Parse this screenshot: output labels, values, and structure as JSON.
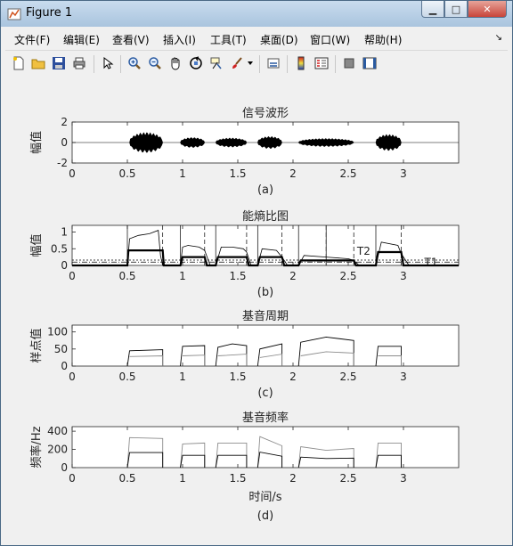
{
  "window": {
    "title": "Figure 1"
  },
  "menu": [
    {
      "label": "文件(F)"
    },
    {
      "label": "编辑(E)"
    },
    {
      "label": "查看(V)"
    },
    {
      "label": "插入(I)"
    },
    {
      "label": "工具(T)"
    },
    {
      "label": "桌面(D)"
    },
    {
      "label": "窗口(W)"
    },
    {
      "label": "帮助(H)"
    }
  ],
  "toolbar": [
    {
      "icon": "new-figure-icon"
    },
    {
      "icon": "open-file-icon"
    },
    {
      "icon": "save-icon"
    },
    {
      "icon": "print-icon"
    },
    {
      "icon": "edit-plot-arrow-icon"
    },
    {
      "icon": "zoom-in-icon"
    },
    {
      "icon": "zoom-out-icon"
    },
    {
      "icon": "pan-hand-icon"
    },
    {
      "icon": "rotate-3d-icon"
    },
    {
      "icon": "data-cursor-icon"
    },
    {
      "icon": "brush-icon"
    },
    {
      "icon": "brush-dropdown-icon"
    },
    {
      "icon": "link-plot-icon"
    },
    {
      "icon": "insert-colorbar-icon"
    },
    {
      "icon": "insert-legend-icon"
    },
    {
      "icon": "hide-plot-tools-icon"
    },
    {
      "icon": "show-plot-tools-icon"
    }
  ],
  "colors": {
    "title_bar_top": "#c9dcee",
    "close_button": "#c8453a",
    "plot_line": "#000000",
    "secondary_line": "#8c8c8c"
  },
  "chart_data": [
    {
      "type": "line",
      "title": "信号波形",
      "ylabel": "幅值",
      "caption": "(a)",
      "xlim": [
        0,
        3.5
      ],
      "ylim": [
        -2,
        2
      ],
      "xticks": [
        "0",
        "0.5",
        "1",
        "1.5",
        "2",
        "2.5",
        "3"
      ],
      "yticks": [
        "2",
        "0",
        "-2"
      ],
      "segments": [
        {
          "x": [
            0.52,
            0.82
          ],
          "amplitude": 1.0
        },
        {
          "x": [
            0.98,
            1.2
          ],
          "amplitude": 0.5
        },
        {
          "x": [
            1.3,
            1.58
          ],
          "amplitude": 0.45
        },
        {
          "x": [
            1.68,
            1.9
          ],
          "amplitude": 0.6
        },
        {
          "x": [
            2.05,
            2.55
          ],
          "amplitude": 0.4
        },
        {
          "x": [
            2.75,
            2.98
          ],
          "amplitude": 0.8
        }
      ]
    },
    {
      "type": "line",
      "title": "能熵比图",
      "ylabel": "幅值",
      "caption": "(b)",
      "xlim": [
        0,
        3.5
      ],
      "ylim": [
        0,
        1.2
      ],
      "xticks": [
        "0",
        "0.5",
        "1",
        "1.5",
        "2",
        "2.5",
        "3"
      ],
      "yticks": [
        "1",
        "0.5",
        "0"
      ],
      "annotations": [
        "T2",
        "T1"
      ],
      "thresholds": {
        "T1": 0.1,
        "T2": 0.16
      },
      "series": [
        {
          "x": [
            0,
            0.5,
            0.52,
            0.6,
            0.7,
            0.78,
            0.8,
            0.82,
            0.98,
            1.0,
            1.05,
            1.15,
            1.2,
            1.25,
            1.3,
            1.35,
            1.45,
            1.55,
            1.58,
            1.62,
            1.68,
            1.72,
            1.85,
            1.9,
            1.95,
            2.05,
            2.1,
            2.3,
            2.5,
            2.55,
            2.6,
            2.75,
            2.8,
            2.95,
            2.98,
            3.05,
            3.5
          ],
          "y": [
            0,
            0,
            0.8,
            0.9,
            0.95,
            1.05,
            0.3,
            0,
            0,
            0.55,
            0.6,
            0.55,
            0.45,
            0,
            0,
            0.55,
            0.55,
            0.5,
            0.4,
            0,
            0,
            0.5,
            0.45,
            0.25,
            0,
            0,
            0.3,
            0.25,
            0.2,
            0.15,
            0,
            0,
            0.7,
            0.6,
            0.35,
            0,
            0
          ]
        },
        {
          "x": [
            0,
            0.5,
            0.51,
            0.82,
            0.83,
            0.98,
            1.0,
            1.2,
            1.22,
            1.3,
            1.32,
            1.58,
            1.6,
            1.68,
            1.7,
            1.9,
            1.92,
            2.05,
            2.07,
            2.55,
            2.57,
            2.75,
            2.77,
            2.98,
            3.0,
            3.5
          ],
          "y": [
            0,
            0,
            0.45,
            0.45,
            0,
            0,
            0.25,
            0.25,
            0,
            0,
            0.25,
            0.25,
            0,
            0,
            0.25,
            0.25,
            0,
            0,
            0.15,
            0.15,
            0,
            0,
            0.4,
            0.4,
            0,
            0
          ]
        }
      ],
      "markers": {
        "solid": [
          0.5,
          0.98,
          1.3,
          1.68,
          2.05,
          2.3,
          2.75
        ],
        "dashed": [
          0.82,
          1.2,
          1.58,
          1.9,
          2.3,
          2.55,
          2.98
        ]
      }
    },
    {
      "type": "line",
      "title": "基音周期",
      "ylabel": "样点值",
      "caption": "(c)",
      "xlim": [
        0,
        3.5
      ],
      "ylim": [
        0,
        120
      ],
      "xticks": [
        "0",
        "0.5",
        "1",
        "1.5",
        "2",
        "2.5",
        "3"
      ],
      "yticks": [
        "100",
        "50",
        "0"
      ],
      "series": [
        {
          "name": "",
          "segments": [
            {
              "x": [
                0.5,
                0.52,
                0.82
              ],
              "y": [
                0,
                45,
                48
              ]
            },
            {
              "x": [
                0.98,
                1.0,
                1.2
              ],
              "y": [
                0,
                58,
                60
              ]
            },
            {
              "x": [
                1.3,
                1.32,
                1.45,
                1.58
              ],
              "y": [
                0,
                55,
                65,
                60
              ]
            },
            {
              "x": [
                1.68,
                1.7,
                1.9
              ],
              "y": [
                0,
                50,
                65
              ]
            },
            {
              "x": [
                2.05,
                2.07,
                2.3,
                2.55
              ],
              "y": [
                0,
                70,
                85,
                75
              ]
            },
            {
              "x": [
                2.75,
                2.77,
                2.98
              ],
              "y": [
                0,
                58,
                58
              ]
            }
          ]
        },
        {
          "name": "",
          "segments": [
            {
              "x": [
                0.52,
                0.82
              ],
              "y": [
                28,
                30
              ]
            },
            {
              "x": [
                1.0,
                1.2
              ],
              "y": [
                30,
                32
              ]
            },
            {
              "x": [
                1.32,
                1.58
              ],
              "y": [
                30,
                35
              ]
            },
            {
              "x": [
                1.7,
                1.9
              ],
              "y": [
                25,
                35
              ]
            },
            {
              "x": [
                2.07,
                2.3,
                2.55
              ],
              "y": [
                30,
                42,
                38
              ]
            },
            {
              "x": [
                2.77,
                2.98
              ],
              "y": [
                30,
                30
              ]
            }
          ]
        }
      ]
    },
    {
      "type": "line",
      "title": "基音频率",
      "ylabel": "频率/Hz",
      "xlabel": "时间/s",
      "caption": "(d)",
      "xlim": [
        0,
        3.5
      ],
      "ylim": [
        0,
        450
      ],
      "xticks": [
        "0",
        "0.5",
        "1",
        "1.5",
        "2",
        "2.5",
        "3"
      ],
      "yticks": [
        "400",
        "200",
        "0"
      ],
      "series": [
        {
          "name": "",
          "segments": [
            {
              "x": [
                0.5,
                0.52,
                0.82
              ],
              "y": [
                0,
                330,
                320
              ]
            },
            {
              "x": [
                0.98,
                1.0,
                1.2
              ],
              "y": [
                0,
                260,
                270
              ]
            },
            {
              "x": [
                1.3,
                1.32,
                1.58
              ],
              "y": [
                0,
                270,
                270
              ]
            },
            {
              "x": [
                1.68,
                1.7,
                1.9
              ],
              "y": [
                0,
                340,
                240
              ]
            },
            {
              "x": [
                2.05,
                2.07,
                2.3,
                2.55
              ],
              "y": [
                0,
                230,
                190,
                210
              ]
            },
            {
              "x": [
                2.75,
                2.77,
                2.98
              ],
              "y": [
                0,
                270,
                270
              ]
            }
          ]
        },
        {
          "name": "",
          "segments": [
            {
              "x": [
                0.5,
                0.52,
                0.82
              ],
              "y": [
                0,
                165,
                165
              ]
            },
            {
              "x": [
                0.98,
                1.0,
                1.2
              ],
              "y": [
                0,
                135,
                135
              ]
            },
            {
              "x": [
                1.3,
                1.32,
                1.58
              ],
              "y": [
                0,
                135,
                135
              ]
            },
            {
              "x": [
                1.68,
                1.7,
                1.9
              ],
              "y": [
                0,
                170,
                125
              ]
            },
            {
              "x": [
                2.05,
                2.07,
                2.3,
                2.55
              ],
              "y": [
                0,
                115,
                100,
                105
              ]
            },
            {
              "x": [
                2.75,
                2.77,
                2.98
              ],
              "y": [
                0,
                135,
                135
              ]
            }
          ]
        }
      ]
    }
  ]
}
